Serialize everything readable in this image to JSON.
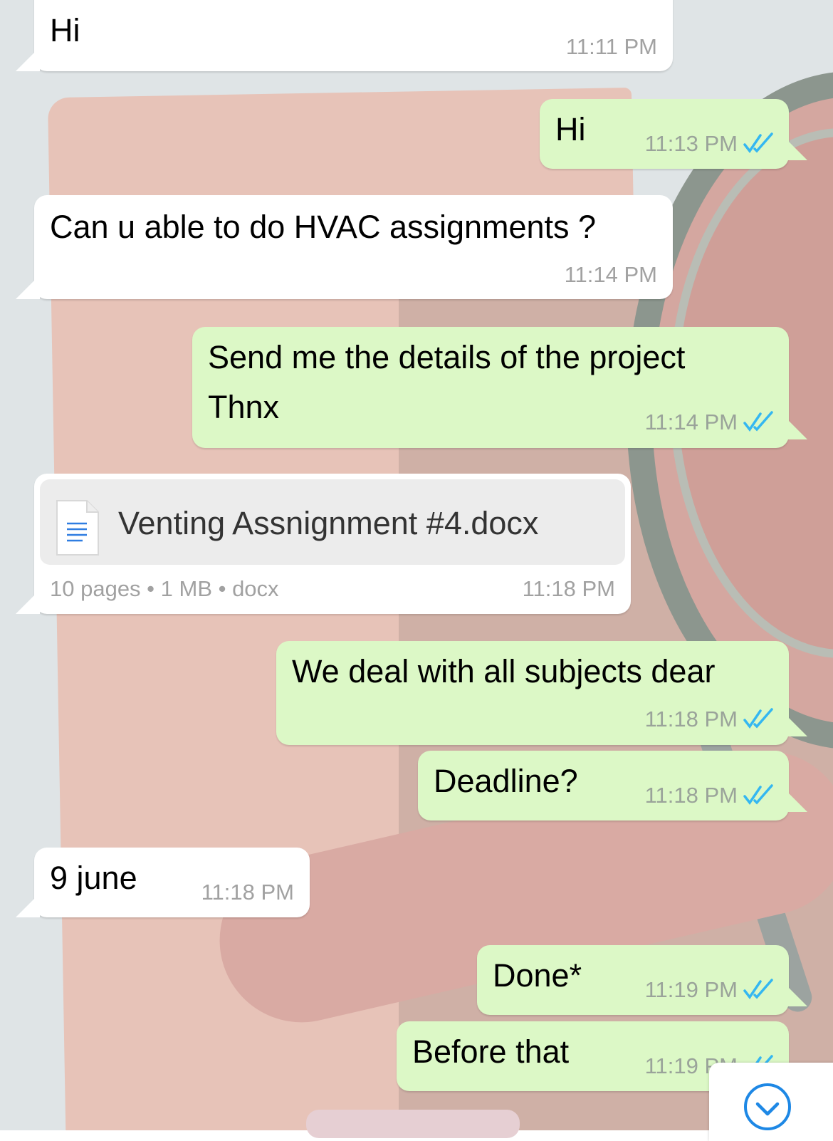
{
  "chat": {
    "messages": [
      {
        "direction": "incoming",
        "text": "Hi",
        "time": "11:11 PM"
      },
      {
        "direction": "outgoing",
        "text": "Hi",
        "time": "11:13 PM",
        "read": true
      },
      {
        "direction": "incoming",
        "text": "Can u able to do HVAC assignments ?",
        "time": "11:14 PM"
      },
      {
        "direction": "outgoing",
        "lines": [
          "Send me the details of the project",
          "Thnx"
        ],
        "time": "11:14 PM",
        "read": true
      },
      {
        "direction": "incoming",
        "type": "document",
        "file_name": "Venting Assnignment #4.docx",
        "meta": "10 pages • 1 MB • docx",
        "time": "11:18 PM"
      },
      {
        "direction": "outgoing",
        "text": "We deal with all subjects dear",
        "time": "11:18 PM",
        "read": true
      },
      {
        "direction": "outgoing",
        "text": "Deadline?",
        "time": "11:18 PM",
        "read": true
      },
      {
        "direction": "incoming",
        "text": "9 june",
        "time": "11:18 PM"
      },
      {
        "direction": "outgoing",
        "text": "Done*",
        "time": "11:19 PM",
        "read": true
      },
      {
        "direction": "outgoing",
        "text": "Before that",
        "time": "11:19 PM",
        "read": true
      }
    ],
    "colors": {
      "incoming_bubble": "#ffffff",
      "outgoing_bubble": "#dcf8c6",
      "read_ticks": "#34b7f1"
    },
    "icons": {
      "read_receipt": "double-check-icon",
      "document": "document-icon",
      "scroll_down": "chevron-down-icon"
    }
  }
}
